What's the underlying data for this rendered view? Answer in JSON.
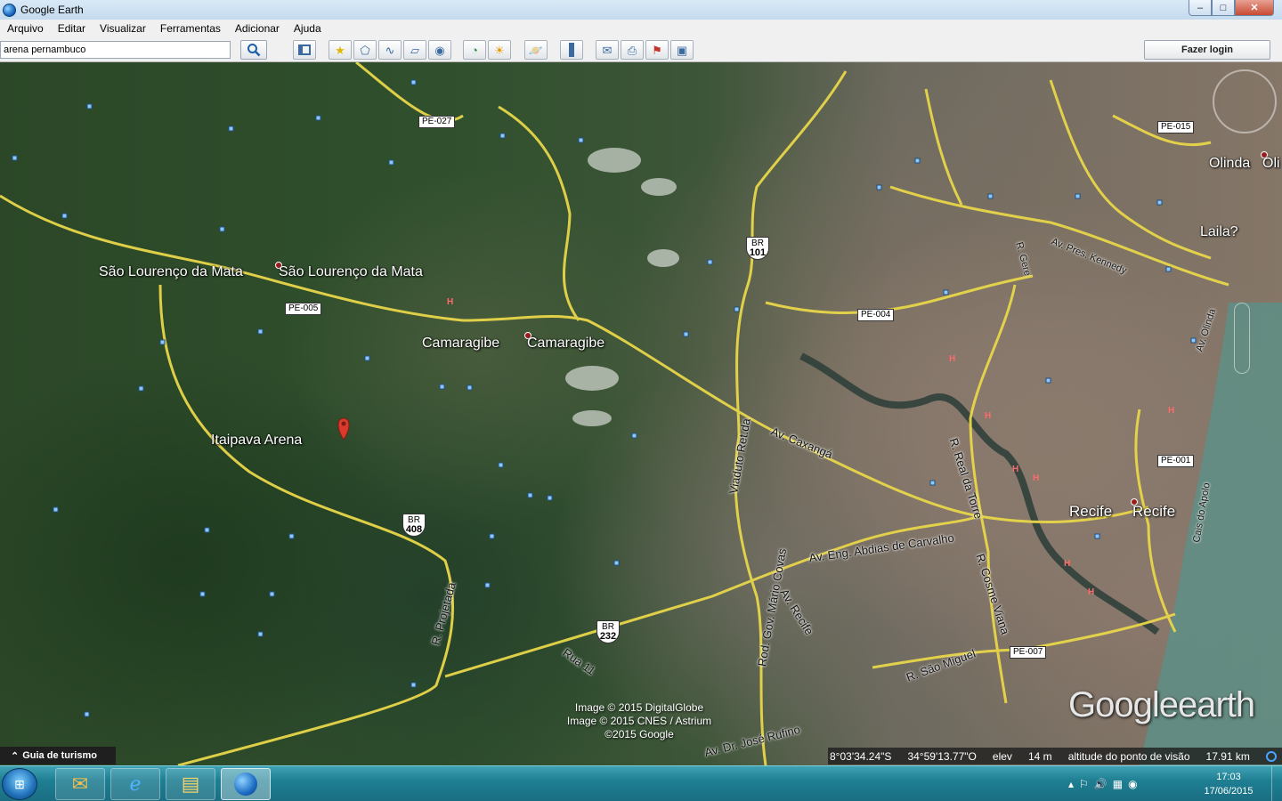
{
  "window": {
    "title": "Google Earth",
    "minimize_label": "‒",
    "maximize_label": "□",
    "close_label": "✕"
  },
  "menu": [
    "Arquivo",
    "Editar",
    "Visualizar",
    "Ferramentas",
    "Adicionar",
    "Ajuda"
  ],
  "search": {
    "value": "arena pernambuco"
  },
  "toolbar": {
    "login_label": "Fazer login",
    "icons": [
      "sidebar-toggle-icon",
      "placemark-icon",
      "polygon-icon",
      "path-icon",
      "image-overlay-icon",
      "record-tour-icon",
      "historical-imagery-icon",
      "sunlight-icon",
      "planets-icon",
      "ruler-icon",
      "email-icon",
      "print-icon",
      "google-maps-icon",
      "save-image-icon"
    ]
  },
  "map": {
    "places": [
      {
        "name": "São Lourenço da Mata",
        "id": "sao-lourenco-1"
      },
      {
        "name": "São Lourenço da Mata",
        "id": "sao-lourenco-2"
      },
      {
        "name": "Camaragibe",
        "id": "camaragibe-1"
      },
      {
        "name": "Camaragibe",
        "id": "camaragibe-2"
      },
      {
        "name": "Itaipava Arena",
        "id": "itaipava-arena"
      },
      {
        "name": "Recife",
        "id": "recife-1"
      },
      {
        "name": "Recife",
        "id": "recife-2"
      },
      {
        "name": "Olinda",
        "id": "olinda-1"
      },
      {
        "name": "Oli",
        "id": "olinda-2"
      },
      {
        "name": "Laila?",
        "id": "laila"
      }
    ],
    "roads": {
      "av_caxanga": "Av. Caxangá",
      "av_eng_abdias": "Av. Eng. Abdias de Carvalho",
      "r_real_da_torre": "R. Real da Torre",
      "r_cosme_viana": "R. Cosme Viana",
      "r_sao_miguel": "R. São Miguel",
      "av_recife": "Av. Recife",
      "viaduto_ret": "Viaduto Ret.da",
      "rod_gov_mario": "Rod. Gov. Mário Covas",
      "rua_11": "Rua 11",
      "r_projetada": "R. Projetada",
      "av_pres_kennedy": "Av. Pres. Kennedy",
      "av_olinda": "Av. Olinda",
      "cais_do_apolo": "Cais do Apolo",
      "av_dr_jose_rufino": "Av. Dr. José Rufino",
      "r_gere": "R. Gere"
    },
    "shields": {
      "pe027": "PE-027",
      "pe005": "PE-005",
      "pe004": "PE-004",
      "pe001": "PE-001",
      "pe007": "PE-007",
      "pe015": "PE-015",
      "br101_top": "BR",
      "br101_num": "101",
      "br408_top": "BR",
      "br408_num": "408",
      "br232_top": "BR",
      "br232_num": "232"
    },
    "credits": [
      "Image © 2015 DigitalGlobe",
      "Image © 2015 CNES / Astrium",
      "©2015 Google"
    ],
    "logo": {
      "google": "Google",
      "earth": "earth"
    }
  },
  "tour_guide": {
    "label": "Guia de turismo",
    "icon": "chevron-up-icon"
  },
  "status": {
    "lat": "8°03'34.24\"S",
    "lon": "34°59'13.77\"O",
    "elev_label": "elev",
    "elev_value": "14 m",
    "eye_alt_label": "altitude do ponto de visão",
    "eye_alt_value": "17.91 km"
  },
  "taskbar": {
    "time": "17:03",
    "date": "17/06/2015",
    "apps": [
      "outlook-icon",
      "internet-explorer-icon",
      "file-explorer-icon",
      "google-earth-icon"
    ]
  },
  "colors": {
    "road": "#e8d64a",
    "taskbar": "#1f7f93",
    "title_bar": "#c4daee"
  }
}
